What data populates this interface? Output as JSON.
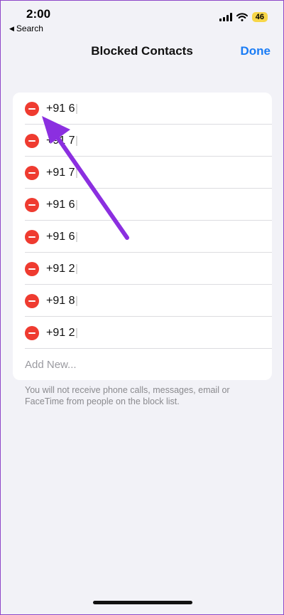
{
  "status_bar": {
    "time": "2:00",
    "back_app": "Search",
    "battery": "46"
  },
  "nav": {
    "title": "Blocked Contacts",
    "done_label": "Done"
  },
  "blocked_list": [
    {
      "number": "+91 6"
    },
    {
      "number": "+91 7"
    },
    {
      "number": "+91 7"
    },
    {
      "number": "+91 6"
    },
    {
      "number": "+91 6"
    },
    {
      "number": "+91 2"
    },
    {
      "number": "+91 8"
    },
    {
      "number": "+91 2"
    }
  ],
  "add_new_label": "Add New...",
  "footer_note": "You will not receive phone calls, messages, email or FaceTime from people on the block list.",
  "colors": {
    "accent": "#1a7cf5",
    "delete": "#ef3b30",
    "arrow": "#8b2fe0",
    "battery": "#f7d648"
  },
  "icons": [
    "back-triangle-icon",
    "cellular-signal-icon",
    "wifi-icon",
    "minus-circle-icon",
    "annotation-arrow-icon"
  ]
}
